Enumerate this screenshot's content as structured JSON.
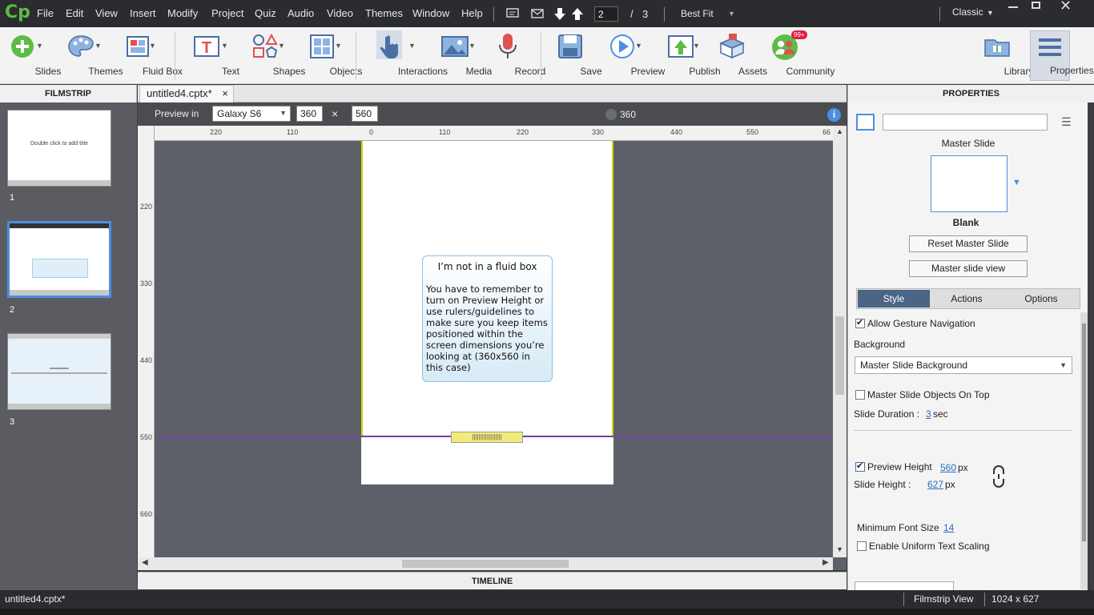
{
  "app": {
    "logo": "Cp"
  },
  "menu": [
    "File",
    "Edit",
    "View",
    "Insert",
    "Modify",
    "Project",
    "Quiz",
    "Audio",
    "Video",
    "Themes",
    "Window",
    "Help"
  ],
  "paging": {
    "current": "2",
    "separator": "/",
    "total": "3",
    "zoom": "Best Fit"
  },
  "workspace": "Classic",
  "toolbar": [
    {
      "label": "Slides",
      "icon": "plus-circle-icon"
    },
    {
      "label": "Themes",
      "icon": "palette-icon"
    },
    {
      "label": "Fluid Box",
      "icon": "fluid-box-icon"
    },
    {
      "label": "Text",
      "icon": "text-icon"
    },
    {
      "label": "Shapes",
      "icon": "shapes-icon"
    },
    {
      "label": "Objects",
      "icon": "objects-icon"
    },
    {
      "label": "Interactions",
      "icon": "hand-pointer-icon"
    },
    {
      "label": "Media",
      "icon": "image-icon"
    },
    {
      "label": "Record",
      "icon": "microphone-icon"
    },
    {
      "label": "Save",
      "icon": "save-icon"
    },
    {
      "label": "Preview",
      "icon": "play-icon"
    },
    {
      "label": "Publish",
      "icon": "publish-icon"
    },
    {
      "label": "Assets",
      "icon": "assets-icon"
    },
    {
      "label": "Community",
      "icon": "community-icon",
      "badge": "99+"
    },
    {
      "label": "Library",
      "icon": "library-icon"
    },
    {
      "label": "Properties",
      "icon": "properties-icon"
    }
  ],
  "filmstrip": {
    "title": "FILMSTRIP",
    "slides": [
      {
        "num": "1",
        "text": "Double click to add title"
      },
      {
        "num": "2",
        "text": ""
      },
      {
        "num": "3",
        "text": ""
      }
    ]
  },
  "document": {
    "tab": "untitled4.cptx*",
    "close": "×"
  },
  "preview": {
    "label": "Preview in",
    "device": "Galaxy S6",
    "width": "360",
    "x": "×",
    "height": "560",
    "marker": "360",
    "info": "i"
  },
  "ruler": {
    "h": [
      "220",
      "110",
      "0",
      "110",
      "220",
      "330",
      "440",
      "550",
      "66"
    ],
    "v": [
      "220",
      "330",
      "440",
      "550",
      "660"
    ]
  },
  "canvas": {
    "box_title": "I’m not in a fluid box",
    "box_body": "You have to remember to turn on Preview Height or use rulers/guidelines to make sure you keep items positioned within the screen dimensions you’re looking at (360x560 in this case)"
  },
  "timeline": "TIMELINE",
  "properties": {
    "title": "PROPERTIES",
    "master_label": "Master Slide",
    "master_name": "Blank",
    "reset_btn": "Reset Master Slide",
    "view_btn": "Master slide view",
    "tabs": [
      "Style",
      "Actions",
      "Options"
    ],
    "allow_gesture": "Allow Gesture Navigation",
    "background_label": "Background",
    "background_value": "Master Slide Background",
    "objects_on_top": "Master Slide Objects On Top",
    "duration_label": "Slide Duration :",
    "duration_value": "3",
    "duration_unit": "sec",
    "preview_height_label": "Preview Height",
    "preview_height_value": "560",
    "slide_height_label": "Slide Height :",
    "slide_height_value": "627",
    "px": "px",
    "min_font_label": "Minimum Font Size",
    "min_font_value": "14",
    "uniform_text": "Enable Uniform Text Scaling"
  },
  "status": {
    "file": "untitled4.cptx*",
    "view": "Filmstrip View",
    "size": "1024 x 627"
  },
  "colors": {
    "accent": "#4a8fe0",
    "logo": "#5dbb46",
    "guide": "#8a2be2",
    "badge": "#e0203a"
  }
}
